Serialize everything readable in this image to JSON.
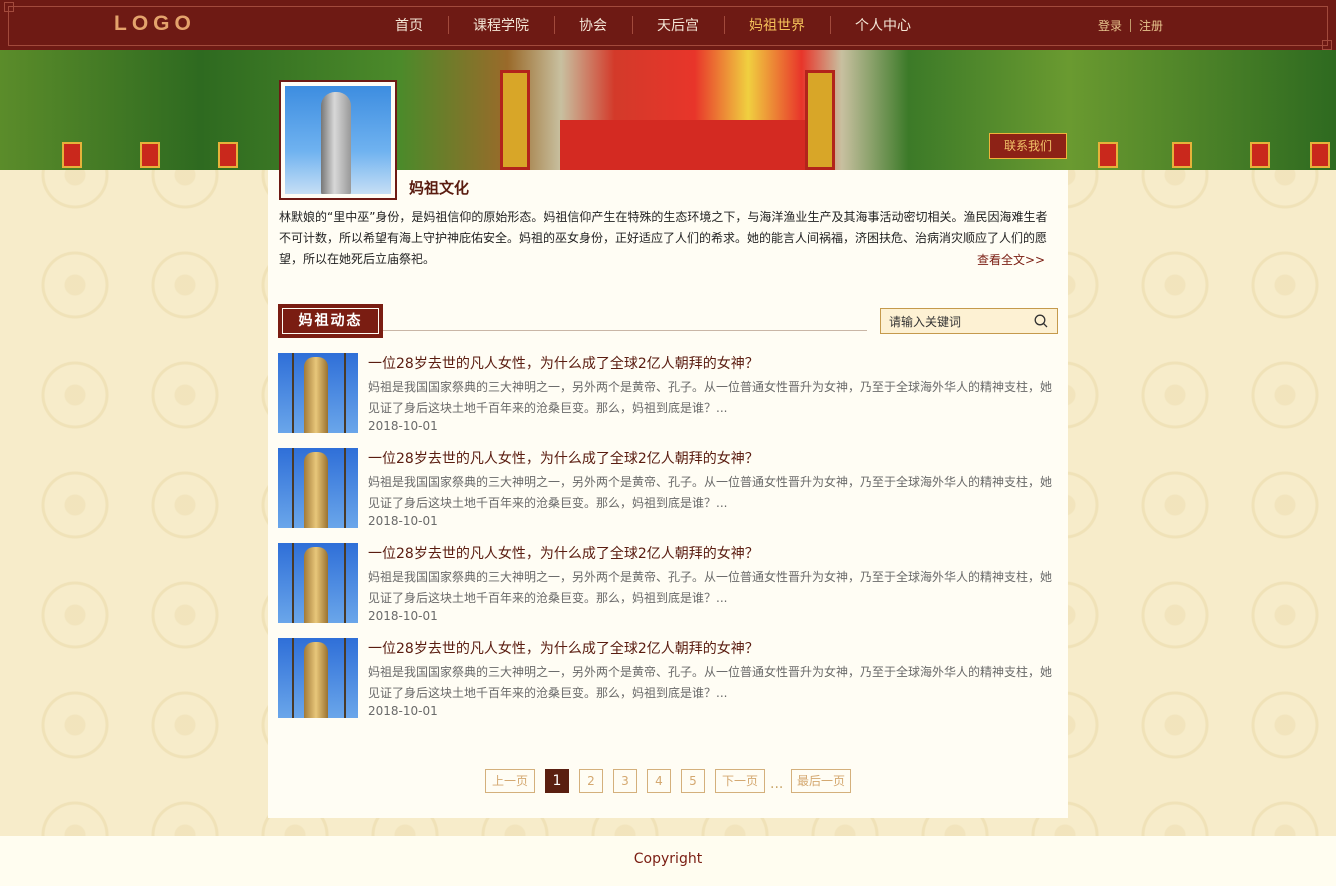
{
  "header": {
    "logo": "LOGO",
    "nav": [
      "首页",
      "课程学院",
      "协会",
      "天后宫",
      "妈祖世界",
      "个人中心"
    ],
    "active_nav": "妈祖世界",
    "login": "登录",
    "register": "注册"
  },
  "banner": {
    "contact_button": "联系我们"
  },
  "culture": {
    "title": "妈祖文化",
    "text": "林默娘的“里中巫”身份，是妈祖信仰的原始形态。妈祖信仰产生在特殊的生态环境之下，与海洋渔业生产及其海事活动密切相关。渔民因海难生者不可计数，所以希望有海上守护神庇佑安全。妈祖的巫女身份，正好适应了人们的希求。她的能言人间祸福，济困扶危、治病消灾顺应了人们的愿望，所以在她死后立庙祭祀。",
    "more": "查看全文>>"
  },
  "news_section": {
    "title": "妈祖动态",
    "search_placeholder": "请输入关键词"
  },
  "news": [
    {
      "title": "一位28岁去世的凡人女性，为什么成了全球2亿人朝拜的女神？",
      "desc": "妈祖是我国国家祭典的三大神明之一，另外两个是黄帝、孔子。从一位普通女性晋升为女神，乃至于全球海外华人的精神支柱，她见证了身后这块土地千百年来的沧桑巨变。那么，妈祖到底是谁？...",
      "date": "2018-10-01"
    },
    {
      "title": "一位28岁去世的凡人女性，为什么成了全球2亿人朝拜的女神？",
      "desc": "妈祖是我国国家祭典的三大神明之一，另外两个是黄帝、孔子。从一位普通女性晋升为女神，乃至于全球海外华人的精神支柱，她见证了身后这块土地千百年来的沧桑巨变。那么，妈祖到底是谁？...",
      "date": "2018-10-01"
    },
    {
      "title": "一位28岁去世的凡人女性，为什么成了全球2亿人朝拜的女神？",
      "desc": "妈祖是我国国家祭典的三大神明之一，另外两个是黄帝、孔子。从一位普通女性晋升为女神，乃至于全球海外华人的精神支柱，她见证了身后这块土地千百年来的沧桑巨变。那么，妈祖到底是谁？...",
      "date": "2018-10-01"
    },
    {
      "title": "一位28岁去世的凡人女性，为什么成了全球2亿人朝拜的女神？",
      "desc": "妈祖是我国国家祭典的三大神明之一，另外两个是黄帝、孔子。从一位普通女性晋升为女神，乃至于全球海外华人的精神支柱，她见证了身后这块土地千百年来的沧桑巨变。那么，妈祖到底是谁？...",
      "date": "2018-10-01"
    }
  ],
  "pagination": {
    "prev": "上一页",
    "pages": [
      "1",
      "2",
      "3",
      "4",
      "5"
    ],
    "current": "1",
    "next": "下一页",
    "ellipsis": "...",
    "last": "最后一页"
  },
  "footer": {
    "copyright": "Copyright"
  },
  "colors": {
    "header_bg": "#6e1a14",
    "active_nav": "#f4c05a",
    "accent": "#7a1d12",
    "page_bg": "#f7ecca"
  }
}
